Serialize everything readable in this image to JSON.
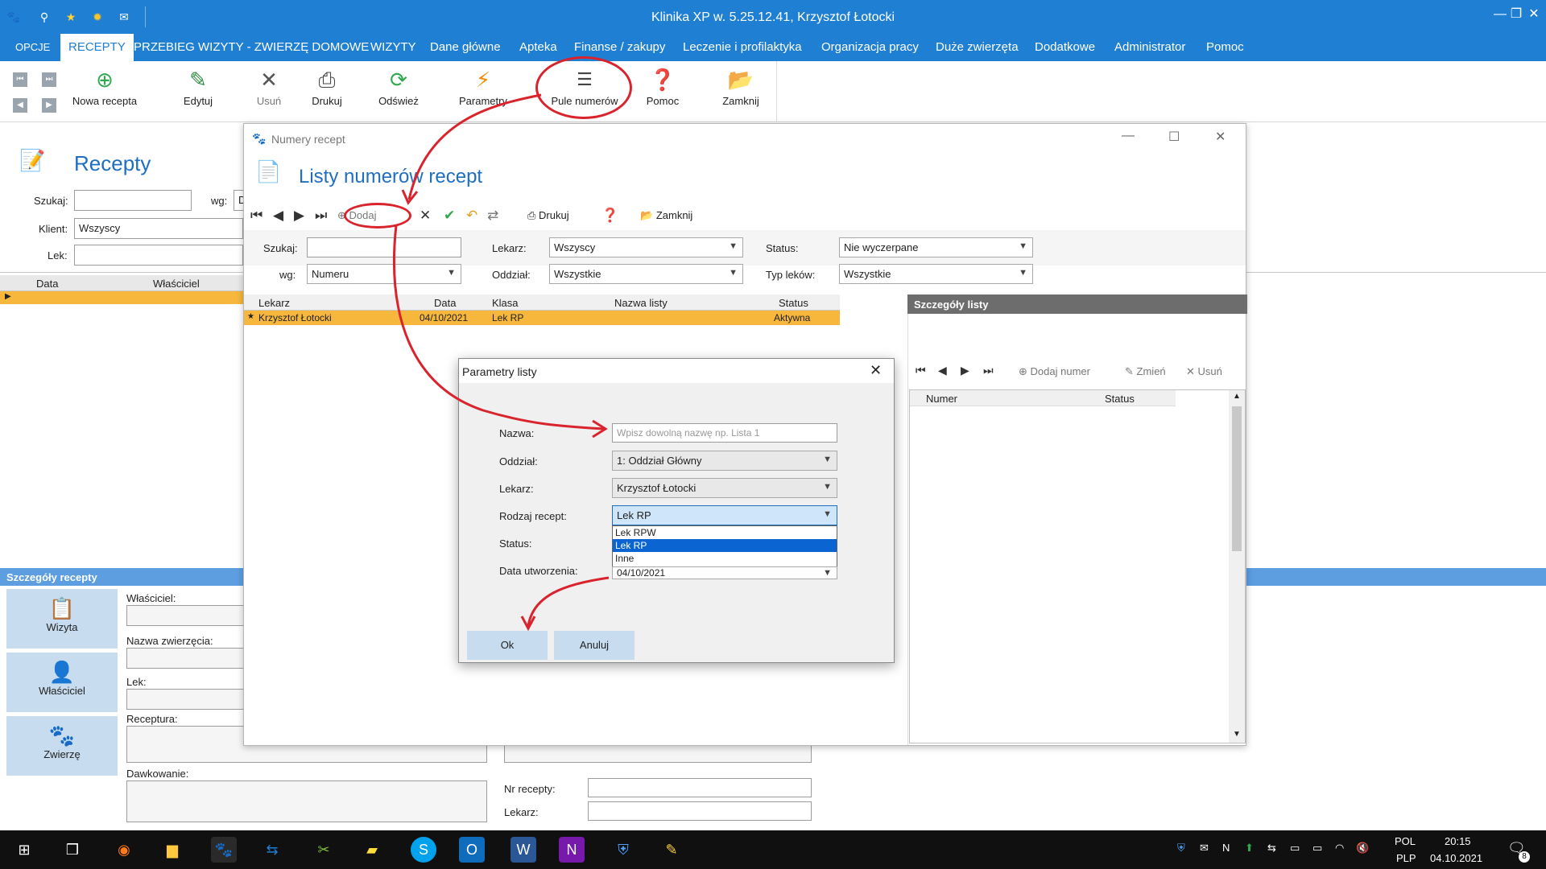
{
  "app": {
    "title": "Klinika XP w. 5.25.12.41, Krzysztof Łotocki"
  },
  "menu": {
    "items": [
      "OPCJE",
      "RECEPTY",
      "PRZEBIEG WIZYTY - ZWIERZĘ DOMOWE",
      "WIZYTY",
      "Dane główne",
      "Apteka",
      "Finanse / zakupy",
      "Leczenie i profilaktyka",
      "Organizacja pracy",
      "Duże zwierzęta",
      "Dodatkowe",
      "Administrator",
      "Pomoc"
    ],
    "active": "RECEPTY"
  },
  "ribbon": {
    "nowa": "Nowa recepta",
    "edytuj": "Edytuj",
    "usun": "Usuń",
    "drukuj": "Drukuj",
    "odswiez": "Odśwież",
    "parametry": "Parametry",
    "pule": "Pule numerów",
    "pomoc": "Pomoc",
    "zamknij": "Zamknij"
  },
  "recepty": {
    "title": "Recepty",
    "szukaj_label": "Szukaj:",
    "wg_label": "wg:",
    "wg_value": "D",
    "klient_label": "Klient:",
    "klient_value": "Wszyscy",
    "lek_label": "Lek:",
    "col_data": "Data",
    "col_wlasciciel": "Właściciel"
  },
  "details": {
    "header": "Szczegóły recepty",
    "wizyta": "Wizyta",
    "wlasciciel_btn": "Właściciel",
    "zwierze": "Zwierzę",
    "wlasciciel_label": "Właściciel:",
    "nazwa_zwierzecia": "Nazwa zwierzęcia:",
    "lek": "Lek:",
    "receptura": "Receptura:",
    "dawkowanie": "Dawkowanie:",
    "nr_recepty": "Nr recepty:",
    "lekarz": "Lekarz:"
  },
  "numery": {
    "window_title": "Numery recept",
    "heading": "Listy numerów recept",
    "toolbar": {
      "dodaj": "Dodaj",
      "drukuj": "Drukuj",
      "zamknij": "Zamknij"
    },
    "filters": {
      "szukaj_label": "Szukaj:",
      "wg_label": "wg:",
      "wg_value": "Numeru",
      "lekarz_label": "Lekarz:",
      "lekarz_value": "Wszyscy",
      "oddzial_label": "Oddział:",
      "oddzial_value": "Wszystkie",
      "status_label": "Status:",
      "status_value": "Nie wyczerpane",
      "typ_label": "Typ leków:",
      "typ_value": "Wszystkie"
    },
    "columns": [
      "Lekarz",
      "Data",
      "Klasa",
      "Nazwa listy",
      "Status"
    ],
    "rows": [
      {
        "lekarz": "Krzysztof Łotocki",
        "data": "04/10/2021",
        "klasa": "Lek RP",
        "nazwa": "",
        "status": "Aktywna"
      }
    ],
    "details_panel": {
      "header": "Szczegóły listy",
      "dodaj_numer": "Dodaj numer",
      "zmien": "Zmień",
      "usun": "Usuń",
      "col_numer": "Numer",
      "col_status": "Status"
    }
  },
  "dialog": {
    "title": "Parametry listy",
    "nazwa_label": "Nazwa:",
    "nazwa_placeholder": "Wpisz dowolną nazwę np. Lista 1",
    "oddzial_label": "Oddział:",
    "oddzial_value": "1: Oddział Główny",
    "lekarz_label": "Lekarz:",
    "lekarz_value": "Krzysztof Łotocki",
    "rodzaj_label": "Rodzaj recept:",
    "rodzaj_value": "Lek RP",
    "status_label": "Status:",
    "data_label": "Data utworzenia:",
    "data_value": "04/10/2021",
    "options": [
      "Lek RPW",
      "Lek RP",
      "Inne"
    ],
    "selected_option": "Lek RP",
    "ok": "Ok",
    "anuluj": "Anuluj"
  },
  "taskbar": {
    "lang1": "POL",
    "lang2": "PLP",
    "time": "20:15",
    "date": "04.10.2021",
    "notif_count": "8"
  },
  "colors": {
    "accent": "#1f7fd3",
    "row_highlight": "#f6b73c",
    "annotation": "#d9232d"
  }
}
